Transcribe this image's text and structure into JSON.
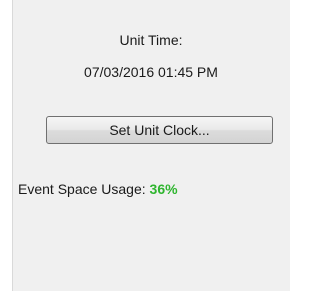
{
  "unit_time": {
    "label": "Unit Time:",
    "value": "07/03/2016 01:45 PM"
  },
  "set_clock": {
    "label": "Set Unit Clock..."
  },
  "event_space": {
    "label": "Event Space Usage:",
    "value": "36%",
    "value_color": "#2fb52f"
  },
  "colors": {
    "panel_background": "#f0f0f0",
    "border": "#d9d9d9"
  }
}
